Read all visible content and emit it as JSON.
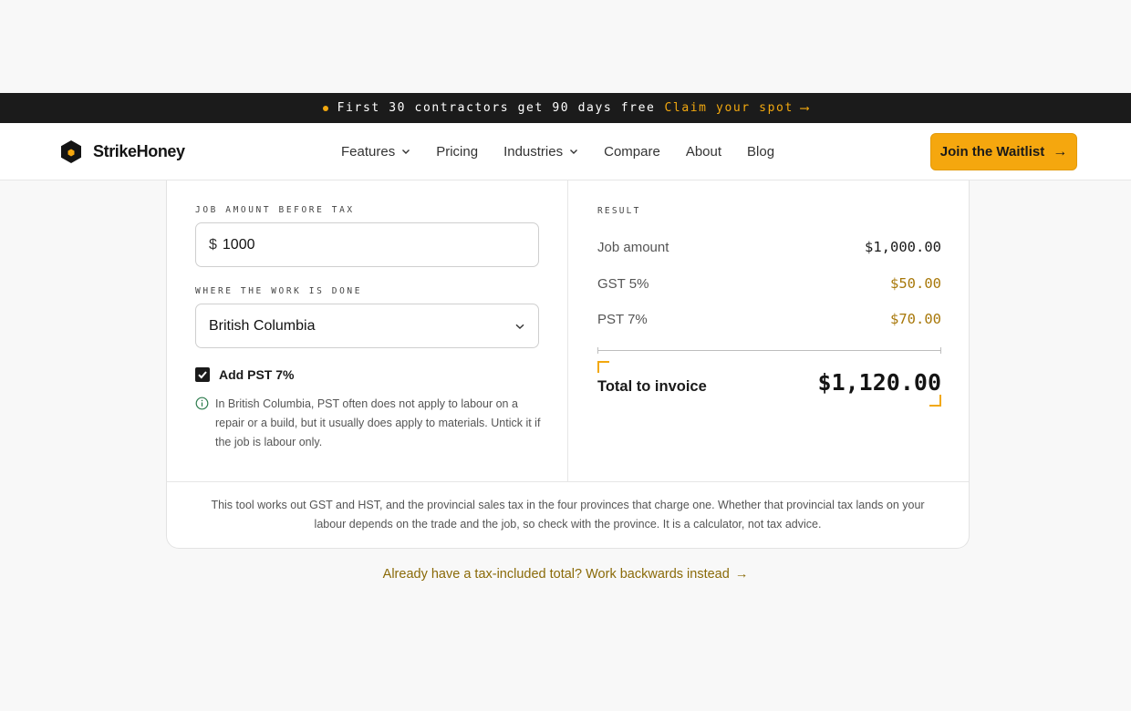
{
  "announcement": {
    "text": "First 30 contractors get 90 days free",
    "link_label": "Claim your spot",
    "arrow": "⟶"
  },
  "brand": {
    "name": "StrikeHoney",
    "logo_icon": "hexagon-logo-icon",
    "accent_color": "#f5a70e"
  },
  "nav": {
    "items": [
      {
        "label": "Features",
        "has_dropdown": true
      },
      {
        "label": "Pricing",
        "has_dropdown": false
      },
      {
        "label": "Industries",
        "has_dropdown": true
      },
      {
        "label": "Compare",
        "has_dropdown": false
      },
      {
        "label": "About",
        "has_dropdown": false
      },
      {
        "label": "Blog",
        "has_dropdown": false
      }
    ],
    "cta_label": "Join the Waitlist",
    "cta_arrow": "→"
  },
  "calculator": {
    "amount_label": "JOB AMOUNT BEFORE TAX",
    "currency_symbol": "$",
    "amount_value": "1000",
    "province_label": "WHERE THE WORK IS DONE",
    "province_value": "British Columbia",
    "pst_checkbox_label": "Add PST 7%",
    "pst_checked": true,
    "pst_note": "In British Columbia, PST often does not apply to labour on a repair or a build, but it usually does apply to materials. Untick it if the job is labour only."
  },
  "result": {
    "label": "RESULT",
    "rows": [
      {
        "label": "Job amount",
        "value": "$1,000.00"
      },
      {
        "label": "GST 5%",
        "value": "$50.00"
      },
      {
        "label": "PST 7%",
        "value": "$70.00"
      }
    ],
    "total_label": "Total to invoice",
    "total_value": "$1,120.00"
  },
  "disclaimer": "This tool works out GST and HST, and the provincial sales tax in the four provinces that charge one. Whether that provincial tax lands on your labour depends on the trade and the job, so check with the province. It is a calculator, not tax advice.",
  "back_link": {
    "label": "Already have a tax-included total? Work backwards instead",
    "arrow": "→"
  }
}
